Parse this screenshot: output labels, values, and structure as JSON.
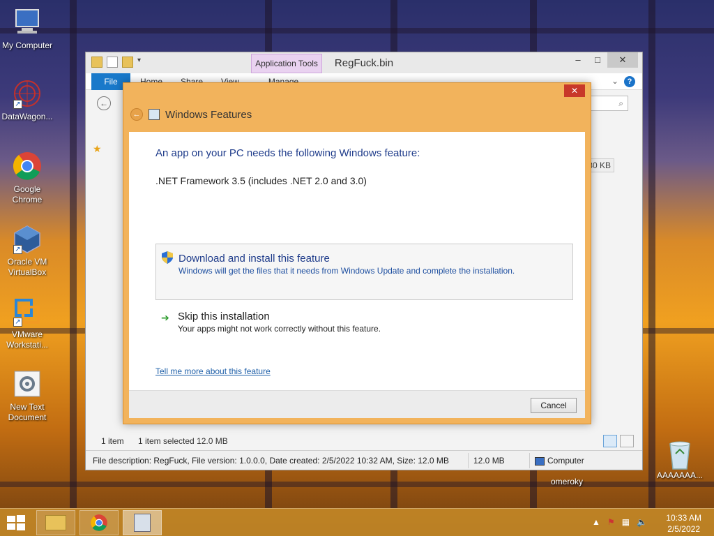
{
  "desktop": {
    "icons": [
      {
        "label": "My Computer"
      },
      {
        "label": "DataWagon..."
      },
      {
        "label": "Google Chrome"
      },
      {
        "label": "Oracle VM VirtualBox"
      },
      {
        "label": "VMware Workstati..."
      },
      {
        "label": "New Text Document"
      }
    ],
    "recycle_label": "AAAAAAA...",
    "user_label": "omeroky"
  },
  "explorer": {
    "title": "RegFuck.bin",
    "context_tab": "Application Tools",
    "file_tab": "File",
    "tabs": [
      "Home",
      "Share",
      "View",
      "Manage"
    ],
    "size_cell": "30 KB",
    "status_count": "1 item",
    "status_selected": "1 item selected  12.0 MB",
    "detail_desc": "File description: RegFuck, File version: 1.0.0.0, Date created: 2/5/2022 10:32 AM, Size: 12.0 MB",
    "detail_size": "12.0 MB",
    "detail_location": "Computer"
  },
  "dialog": {
    "title": "Windows Features",
    "intro": "An app on your PC needs the following Windows feature:",
    "feature": ".NET Framework 3.5 (includes .NET 2.0 and 3.0)",
    "option_download_title": "Download and install this feature",
    "option_download_sub": "Windows will get the files that it needs from Windows Update and complete the installation.",
    "option_skip_title": "Skip this installation",
    "option_skip_sub": "Your apps might not work correctly without this feature.",
    "link_more": "Tell me more about this feature",
    "cancel_label": "Cancel"
  },
  "taskbar": {
    "time": "10:33 AM",
    "date": "2/5/2022"
  },
  "colors": {
    "dialog_frame": "#f2b35c",
    "accent_blue": "#1979ca",
    "link_blue": "#1e3b8a"
  }
}
